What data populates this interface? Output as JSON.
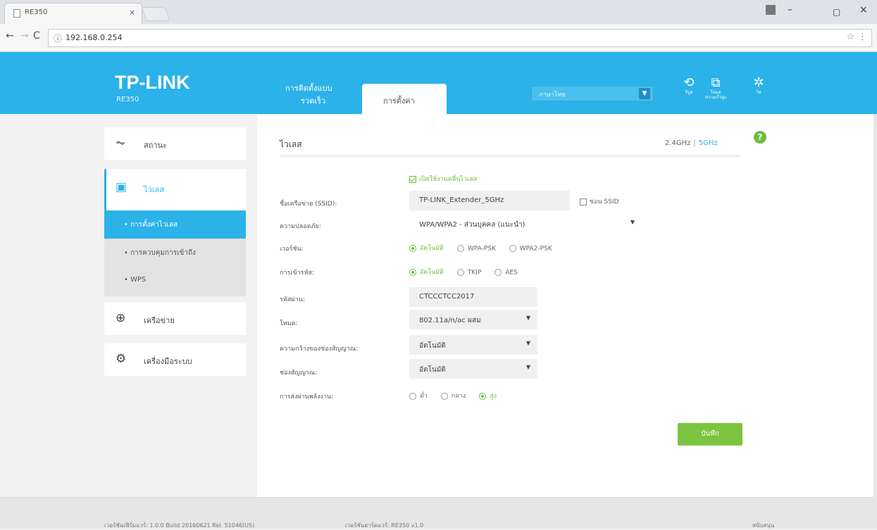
{
  "browser": {
    "tab_title": "RE350",
    "tab_close": "×",
    "url": "192.168.0.254",
    "info_icon": "info-icon",
    "controls": {
      "minimize": "–",
      "maximize": "▢",
      "close": "×"
    }
  },
  "header": {
    "brand": "TP-LINK",
    "model": "RE350",
    "tab_quick_line1": "การติดตั้งแบบ",
    "tab_quick_line2": "รวดเร็ว",
    "tab_settings": "การตั้งค่า",
    "language_value": "ภาษาไทย",
    "icons": [
      {
        "name": "reboot-icon",
        "glyph": "⟲",
        "label": "รีบูต"
      },
      {
        "name": "high-speed-mode-icon",
        "glyph": "⧉",
        "label": "โหมดความเร็วสูง"
      },
      {
        "name": "led-icon",
        "glyph": "✲",
        "label": "ไฟ"
      }
    ]
  },
  "sidebar": {
    "status": "สถานะ",
    "wireless": "ไวเลส",
    "sub": [
      "• การตั้งค่าไวเลส",
      "• การควบคุมการเข้าถึง",
      "• WPS"
    ],
    "network": "เครือข่าย",
    "system_tools": "เครื่องมือระบบ"
  },
  "main": {
    "section_title": "ไวเลส",
    "band_24": "2.4GHz",
    "band_sep": "|",
    "band_5": "5GHz",
    "help": "?",
    "enable_radio": "เปิดใช้งานคลื่นไวเลส",
    "ssid_label": "ชื่อเครือข่าย (SSID):",
    "ssid_value": "TP-LINK_Extender_5GHz",
    "hide_ssid": "ซ่อน SSID",
    "security_label": "ความปลอดภัย:",
    "security_value": "WPA/WPA2 - ส่วนบุคคล (แนะนำ)",
    "version_label": "เวอร์ชัน:",
    "version_options": [
      "อัตโนมัติ",
      "WPA-PSK",
      "WPA2-PSK"
    ],
    "encryption_label": "การเข้ารหัส:",
    "encryption_options": [
      "อัตโนมัติ",
      "TKIP",
      "AES"
    ],
    "password_label": "รหัสผ่าน:",
    "password_value": "CTCCCTCC2017",
    "mode_label": "โหมด:",
    "mode_value": "802.11a/n/ac ผสม",
    "channel_width_label": "ความกว้างของช่องสัญญาณ:",
    "channel_width_value": "อัตโนมัติ",
    "channel_label": "ช่องสัญญาณ:",
    "channel_value": "อัตโนมัติ",
    "tx_power_label": "การส่งผ่านพลังงาน:",
    "tx_power_options": [
      "ต่ำ",
      "กลาง",
      "สูง"
    ],
    "save": "บันทึก"
  },
  "footer": {
    "firmware": "เวอร์ชันเฟิร์มแวร์: 1.0.0 Build 20160621 Rel. 51046(US)",
    "hardware": "เวอร์ชันฮาร์ดแวร์: RE350 v1.0",
    "support": "สนับสนุน"
  },
  "colors": {
    "accent": "#2bb2e8",
    "green": "#6cbf3c",
    "save_button": "#7cc440"
  }
}
